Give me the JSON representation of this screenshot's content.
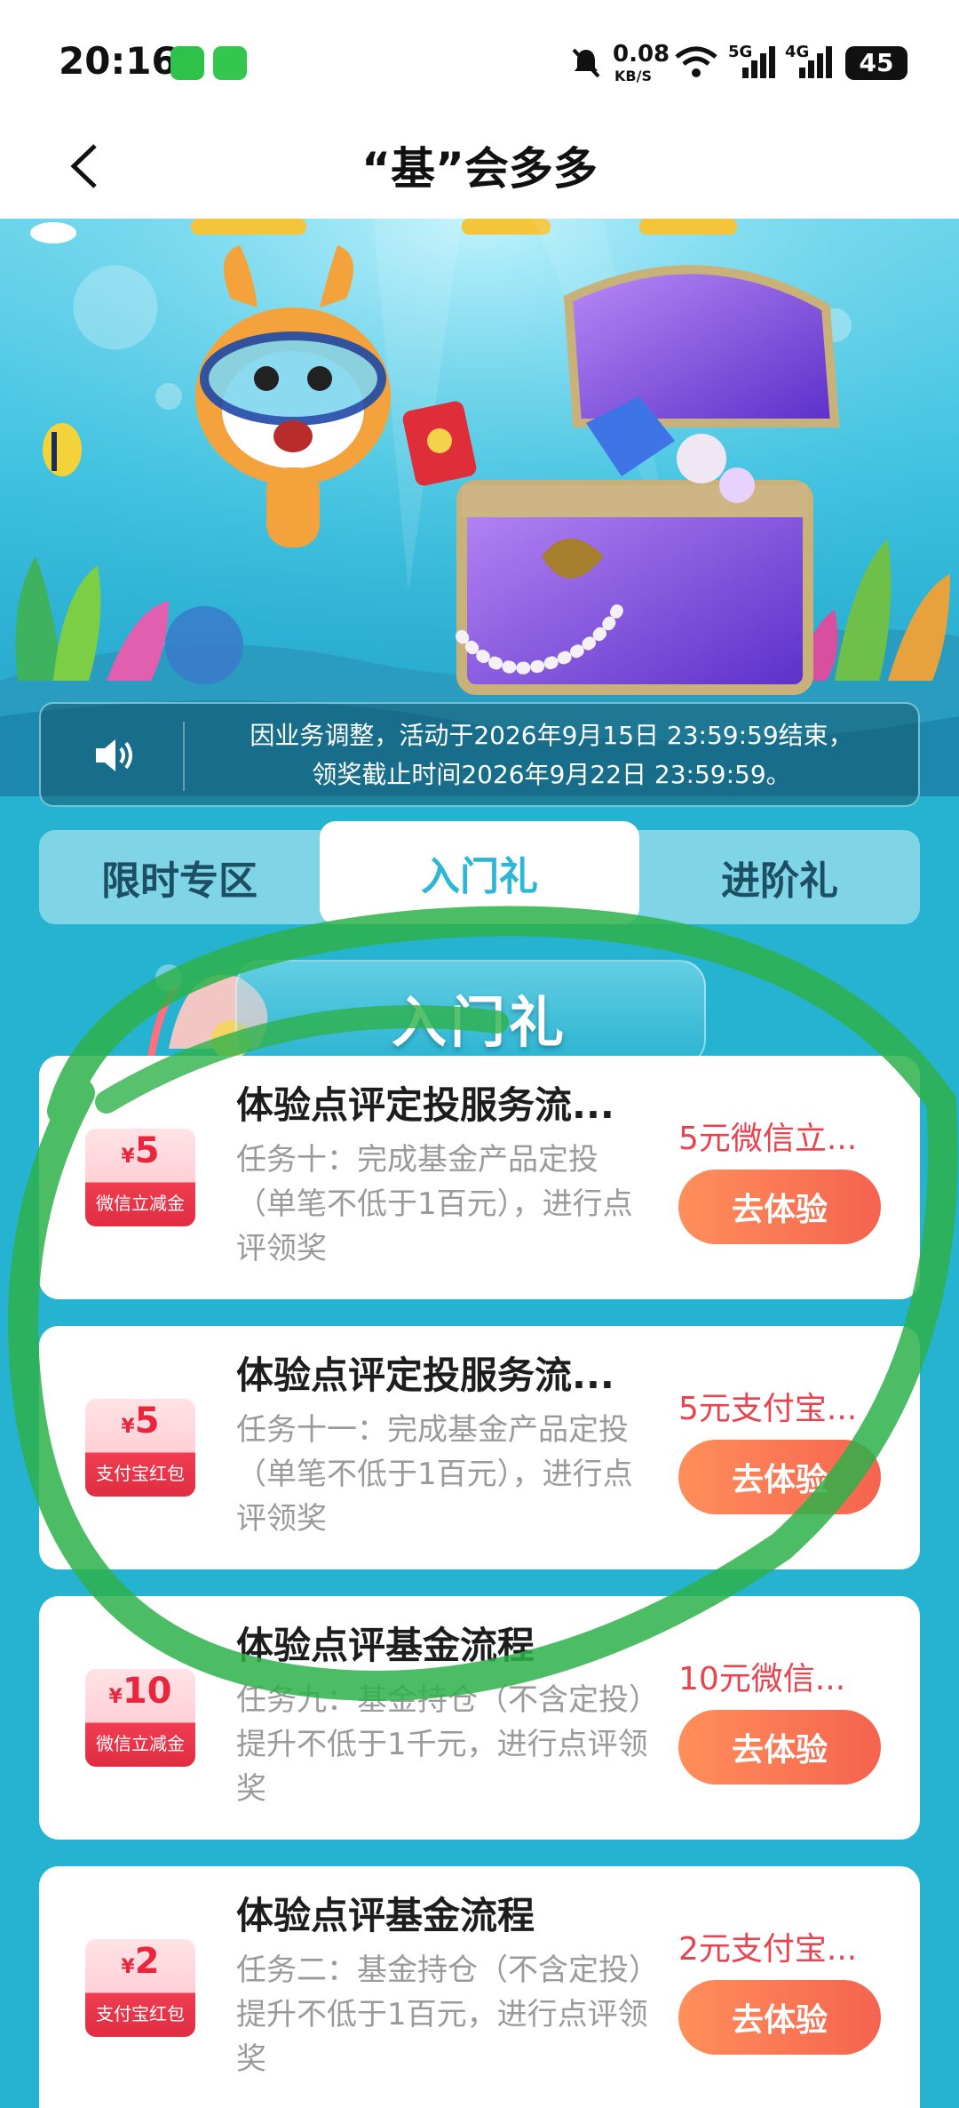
{
  "status": {
    "time": "20:16",
    "net_speed_top": "0.08",
    "net_speed_unit": "KB/S",
    "sig1": "5G",
    "sig2": "4G",
    "battery": "45"
  },
  "header": {
    "title": "“基”会多多"
  },
  "notice": {
    "line1": "因业务调整，活动于2026年9月15日 23:59:59结束，",
    "line2": "领奖截止时间2026年9月22日 23:59:59。"
  },
  "tabs": [
    {
      "label": "限时专区"
    },
    {
      "label": "入门礼"
    },
    {
      "label": "进阶礼"
    }
  ],
  "section_title": "入门礼",
  "tasks": [
    {
      "title": "体验点评定投服务流...",
      "desc": "任务十：完成基金产品定投（单笔不低于1百元），进行点评领奖",
      "coupon_amount": "5",
      "coupon_currency": "¥",
      "coupon_type": "微信立减金",
      "reward": "5元微信立...",
      "button": "去体验"
    },
    {
      "title": "体验点评定投服务流...",
      "desc": "任务十一：完成基金产品定投（单笔不低于1百元），进行点评领奖",
      "coupon_amount": "5",
      "coupon_currency": "¥",
      "coupon_type": "支付宝红包",
      "reward": "5元支付宝...",
      "button": "去体验"
    },
    {
      "title": "体验点评基金流程",
      "desc": "任务九：基金持仓（不含定投）提升不低于1千元，进行点评领奖",
      "coupon_amount": "10",
      "coupon_currency": "¥",
      "coupon_type": "微信立减金",
      "reward": "10元微信...",
      "button": "去体验"
    },
    {
      "title": "体验点评基金流程",
      "desc": "任务二：基金持仓（不含定投）提升不低于1百元，进行点评领奖",
      "coupon_amount": "2",
      "coupon_currency": "¥",
      "coupon_type": "支付宝红包",
      "reward": "2元支付宝...",
      "button": "去体验"
    }
  ],
  "colors": {
    "accent": "#2db6d6",
    "button": "#f5634f",
    "reward": "#e8434f",
    "annotation": "#2eb24a"
  }
}
